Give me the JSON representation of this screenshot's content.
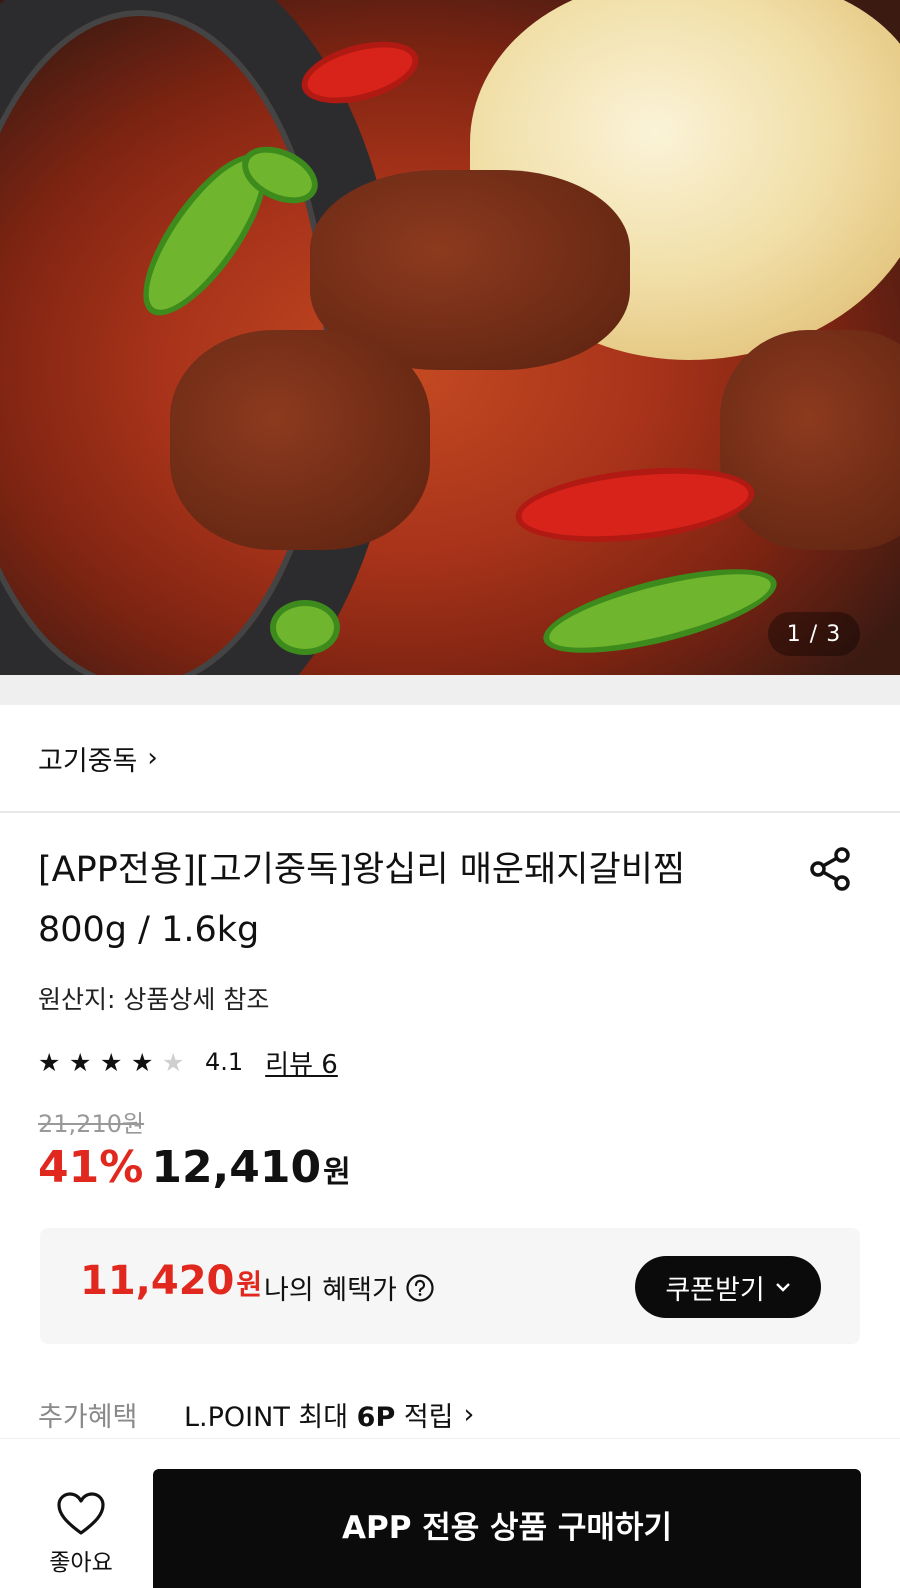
{
  "hero": {
    "image_counter": "1 / 3"
  },
  "brand": {
    "name": "고기중독",
    "chevron": "›"
  },
  "product": {
    "title": "[APP전용][고기중독]왕십리 매운돼지갈비찜 800g / 1.6kg",
    "origin": "원산지: 상품상세 참조",
    "rating_stars": 4,
    "rating_value": "4.1",
    "review_link": "리뷰 6",
    "original_price": "21,210원",
    "discount_rate": "41%",
    "sale_price": "12,410",
    "sale_price_unit": "원"
  },
  "benefit": {
    "price": "11,420",
    "price_unit": "원",
    "label": "나의 혜택가",
    "coupon_button": "쿠폰받기"
  },
  "extra_benefit": {
    "label": "추가혜택",
    "text_prefix": "L.POINT 최대 ",
    "text_bold": "6P",
    "text_suffix": " 적립",
    "chevron": "›"
  },
  "bottom_bar": {
    "like_label": "좋아요",
    "buy_button": "APP 전용 상품 구매하기"
  },
  "colors": {
    "accent_red": "#e0281e",
    "button_black": "#0b0b0b",
    "muted_gray": "#8a8a8a"
  },
  "icons": {
    "share": "share-icon",
    "help": "question-circle-icon",
    "heart": "heart-outline-icon",
    "star": "star-icon"
  }
}
